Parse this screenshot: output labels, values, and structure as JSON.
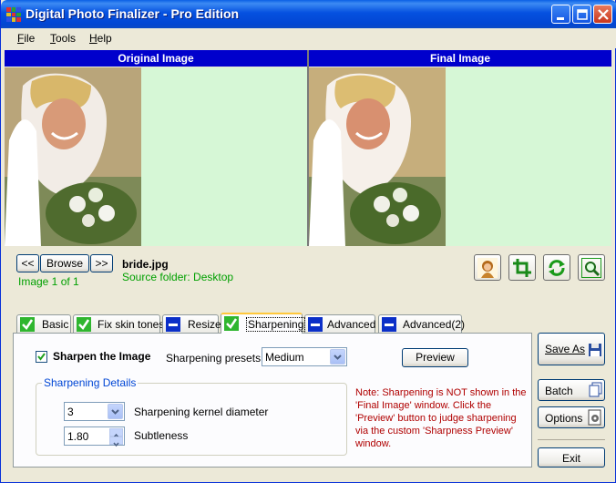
{
  "window": {
    "title": "Digital Photo Finalizer - Pro Edition"
  },
  "menu": [
    {
      "label": "File"
    },
    {
      "label": "Tools"
    },
    {
      "label": "Help"
    }
  ],
  "panels": {
    "original_title": "Original Image",
    "final_title": "Final Image"
  },
  "navigation": {
    "prev_label": "<<",
    "browse_label": "Browse",
    "next_label": ">>",
    "counter": "Image 1 of 1"
  },
  "file": {
    "name": "bride.jpg",
    "source": "Source folder: Desktop"
  },
  "toolbar_icons": [
    "portrait-icon",
    "crop-icon",
    "rotate-icon",
    "zoom-preview-icon"
  ],
  "tabs": [
    {
      "label": "Basic",
      "icon": "checkmark-icon"
    },
    {
      "label": "Fix skin tones",
      "icon": "checkmark-icon"
    },
    {
      "label": "Resize",
      "icon": "minus-icon"
    },
    {
      "label": "Sharpening",
      "icon": "checkmark-icon",
      "active": true
    },
    {
      "label": "Advanced",
      "icon": "minus-icon"
    },
    {
      "label": "Advanced(2)",
      "icon": "minus-icon"
    }
  ],
  "sharpening": {
    "enable_label": "Sharpen the Image",
    "enabled": true,
    "presets_label": "Sharpening presets:",
    "preset_value": "Medium",
    "preview_label": "Preview",
    "details_title": "Sharpening Details",
    "kernel_value": "3",
    "kernel_label": "Sharpening kernel diameter",
    "subtleness_value": "1.80",
    "subtleness_label": "Subtleness",
    "note": "Note: Sharpening is NOT shown in the 'Final Image' window.  Click the 'Preview' button to judge sharpening via the custom 'Sharpness Preview' window."
  },
  "actions": {
    "save_as": "Save As",
    "batch": "Batch",
    "options": "Options",
    "exit": "Exit"
  },
  "colors": {
    "title_blue": "#0246d3",
    "panel_header": "#0000cc",
    "image_bg": "#d6f7d6",
    "accent_green": "#00a000",
    "note_red": "#b00000"
  }
}
